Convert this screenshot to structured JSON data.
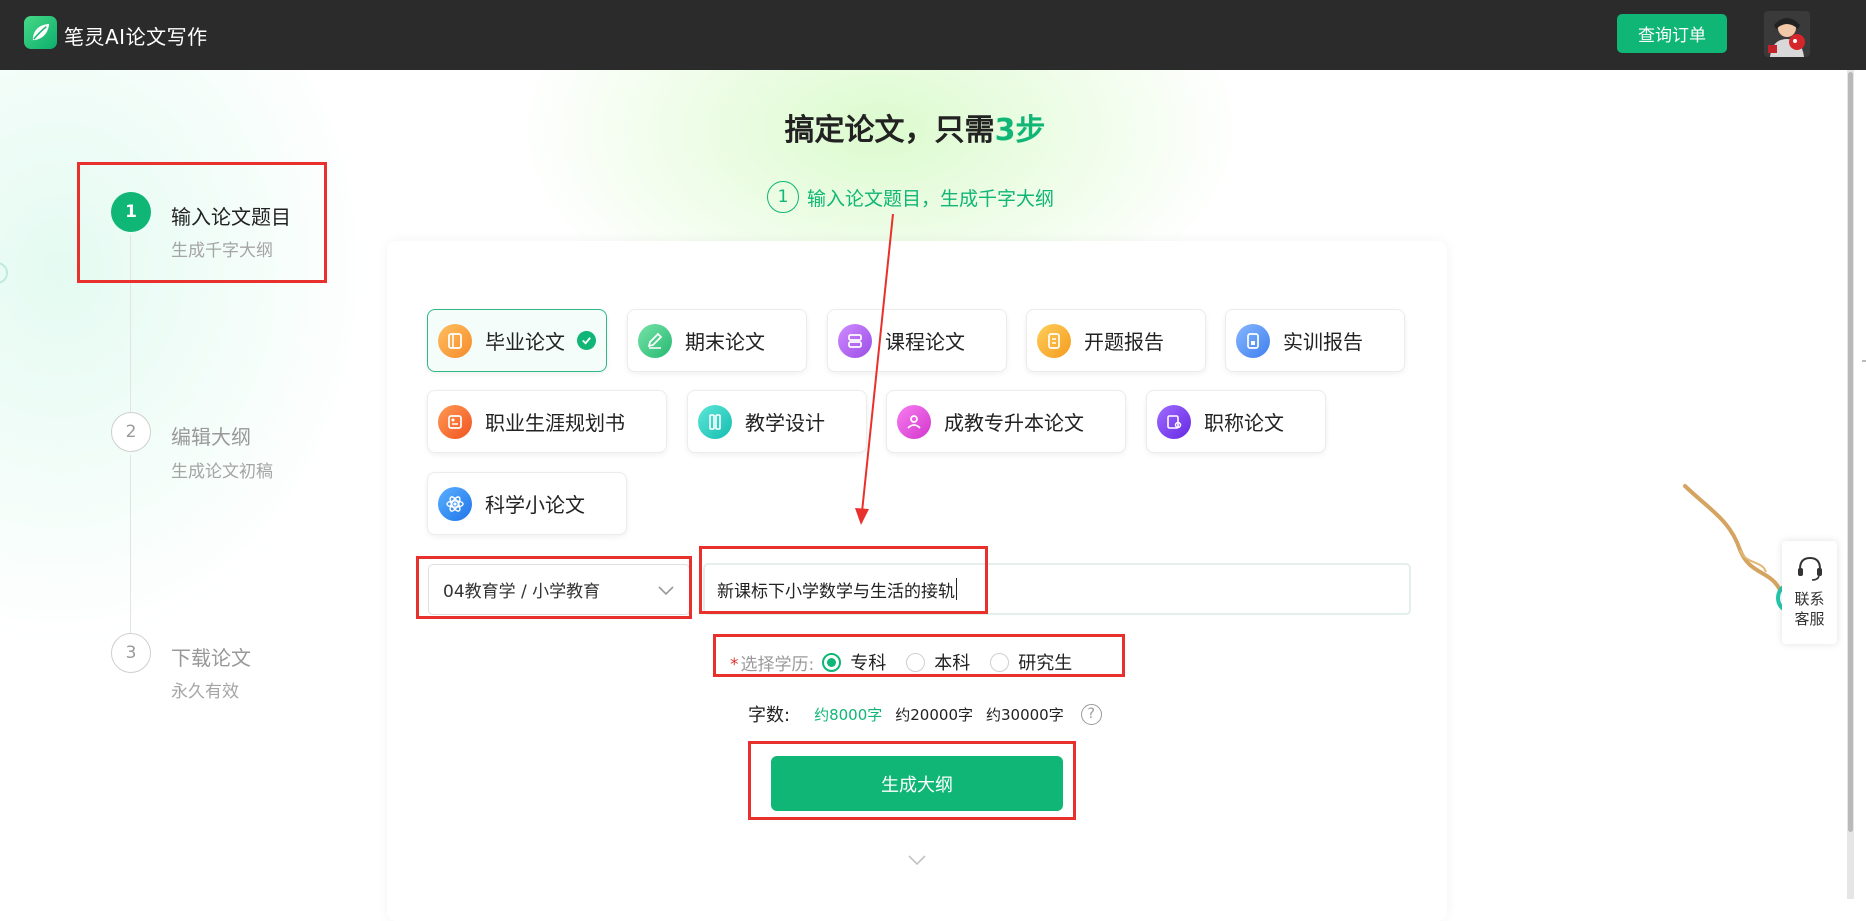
{
  "app": {
    "brand": "笔灵AI论文写作",
    "order_button": "查询订单"
  },
  "steps": [
    {
      "number": "1",
      "title": "输入论文题目",
      "subtitle": "生成千字大纲",
      "active": true
    },
    {
      "number": "2",
      "title": "编辑大纲",
      "subtitle": "生成论文初稿",
      "active": false
    },
    {
      "number": "3",
      "title": "下载论文",
      "subtitle": "永久有效",
      "active": false
    }
  ],
  "headline": {
    "prefix": "搞定论文，只需",
    "accent": "3步"
  },
  "current_step": {
    "number": "1",
    "text": "输入论文题目，生成千字大纲"
  },
  "paper_types": [
    {
      "label": "毕业论文",
      "icon": "notebook-icon",
      "color": "#f7a13c",
      "selected": true
    },
    {
      "label": "期末论文",
      "icon": "pencil-icon",
      "color": "#3cc985",
      "selected": false
    },
    {
      "label": "课程论文",
      "icon": "layers-icon",
      "color": "#b062ea",
      "selected": false
    },
    {
      "label": "开题报告",
      "icon": "document-icon",
      "color": "#f5a623",
      "selected": false
    },
    {
      "label": "实训报告",
      "icon": "report-icon",
      "color": "#4e8ff2",
      "selected": false
    },
    {
      "label": "职业生涯规划书",
      "icon": "career-plan-icon",
      "color": "#f56a2f",
      "selected": false
    },
    {
      "label": "教学设计",
      "icon": "ruler-icon",
      "color": "#23c9c0",
      "selected": false
    },
    {
      "label": "成教专升本论文",
      "icon": "graduate-icon",
      "color": "#e24ad9",
      "selected": false
    },
    {
      "label": "职称论文",
      "icon": "certificate-icon",
      "color": "#7b3ff0",
      "selected": false
    },
    {
      "label": "科学小论文",
      "icon": "atom-icon",
      "color": "#2e86f0",
      "selected": false
    }
  ],
  "form": {
    "subject_value": "04教育学 / 小学教育",
    "topic_value": "新课标下小学数学与生活的接轨",
    "education_label": "选择学历:",
    "required_mark": "*",
    "education_options": [
      {
        "label": "专科",
        "checked": true
      },
      {
        "label": "本科",
        "checked": false
      },
      {
        "label": "研究生",
        "checked": false
      }
    ],
    "word_count_label": "字数:",
    "word_count_options": [
      {
        "label": "约8000字",
        "active": true
      },
      {
        "label": "约20000字",
        "active": false
      },
      {
        "label": "约30000字",
        "active": false
      }
    ],
    "help_glyph": "?",
    "generate_button": "生成大纲"
  },
  "customer_service": {
    "line1": "联系",
    "line2": "客服"
  },
  "colors": {
    "accent": "#0fb676",
    "annotation": "#e8302c",
    "topbar": "#2b2b2b"
  }
}
